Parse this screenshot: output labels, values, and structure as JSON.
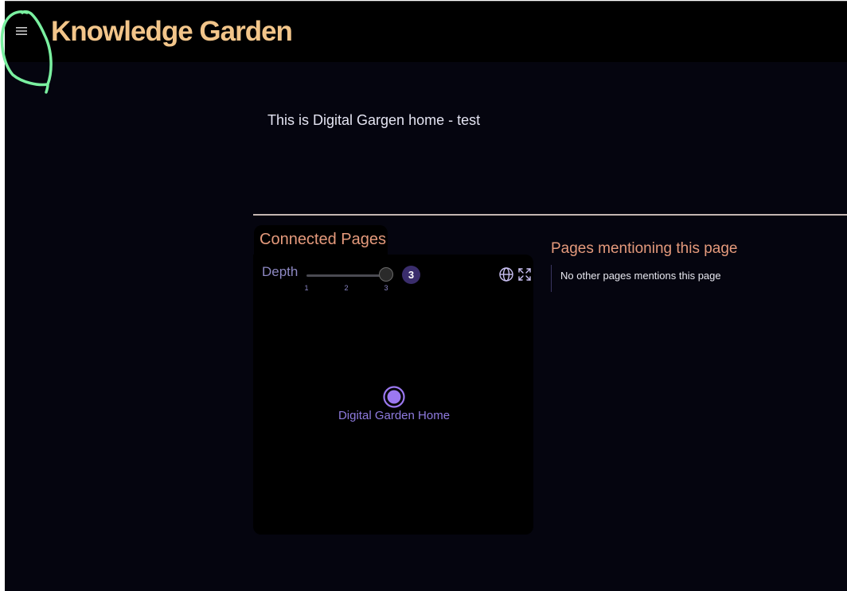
{
  "header": {
    "title": "Knowledge Garden",
    "title_color": "#f2c58a",
    "menu_icon": "hamburger-menu-icon"
  },
  "annotation": {
    "shape": "hand-drawn-loop",
    "color": "#7af0a0"
  },
  "content": {
    "intro_text": "This is Digital Gargen home - test"
  },
  "connected_pages": {
    "title": "Connected Pages",
    "depth_label": "Depth",
    "depth_value": 3,
    "depth_min": 1,
    "depth_max": 3,
    "depth_ticks": [
      "1",
      "2",
      "3"
    ],
    "depth_badge": "3",
    "icons": [
      "globe-icon",
      "expand-icon"
    ],
    "nodes": [
      {
        "label": "Digital Garden Home"
      }
    ],
    "node_color": "#9b78f0"
  },
  "mentions": {
    "title": "Pages mentioning this page",
    "empty_text": "No other pages mentions this page"
  },
  "colors": {
    "background": "#05050f",
    "accent": "#e59a7c"
  }
}
